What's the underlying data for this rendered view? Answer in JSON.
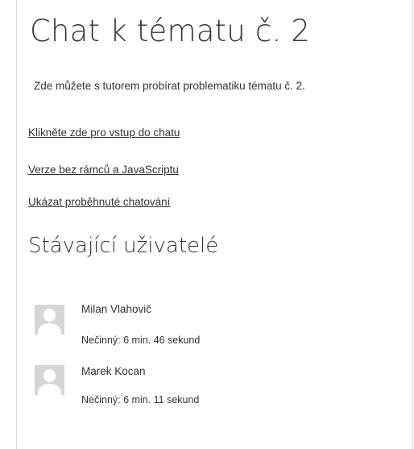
{
  "page": {
    "title": "Chat k tématu č. 2",
    "intro": "Zde můžete s tutorem probírat problematiku tématu č. 2."
  },
  "links": {
    "enter_chat": "Klikněte zde pro vstup do chatu",
    "no_frames": "Verze bez rámců a JavaScriptu",
    "past_sessions": "Ukázat proběhnuté chatování"
  },
  "users": {
    "heading": "Stávající uživatelé",
    "list": [
      {
        "name": "Milan Vlahovič",
        "idle": "Nečinný: 6 min. 46 sekund"
      },
      {
        "name": "Marek Kocan",
        "idle": "Nečinný: 6 min. 11 sekund"
      }
    ]
  }
}
